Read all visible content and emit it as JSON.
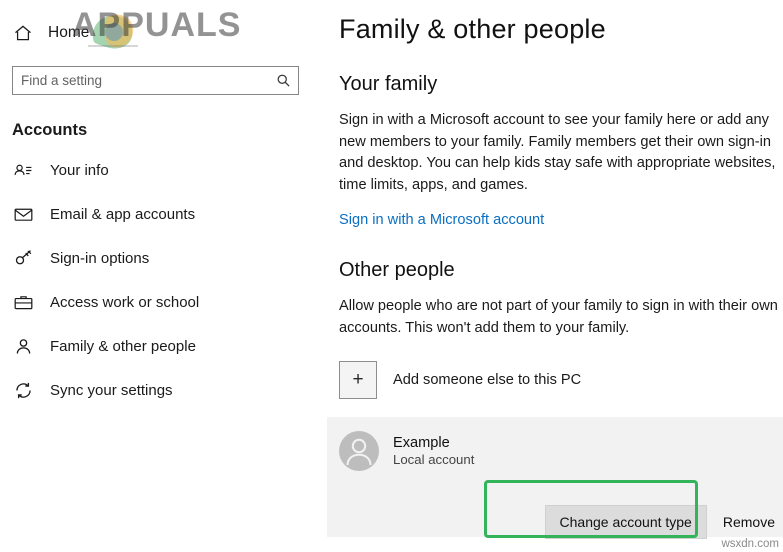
{
  "sidebar": {
    "home": {
      "label": "Home",
      "icon": "home-icon"
    },
    "search": {
      "placeholder": "Find a setting",
      "value": "",
      "icon": "search-icon"
    },
    "section_title": "Accounts",
    "items": [
      {
        "label": "Your info",
        "icon": "id-card-icon"
      },
      {
        "label": "Email & app accounts",
        "icon": "envelope-icon"
      },
      {
        "label": "Sign-in options",
        "icon": "key-icon"
      },
      {
        "label": "Access work or school",
        "icon": "briefcase-icon"
      },
      {
        "label": "Family & other people",
        "icon": "person-icon",
        "selected": true
      },
      {
        "label": "Sync your settings",
        "icon": "sync-icon"
      }
    ]
  },
  "main": {
    "page_title": "Family & other people",
    "family": {
      "heading": "Your family",
      "body": "Sign in with a Microsoft account to see your family here or add any new members to your family. Family members get their own sign-in and desktop. You can help kids stay safe with appropriate websites, time limits, apps, and games.",
      "link": "Sign in with a Microsoft account"
    },
    "other_people": {
      "heading": "Other people",
      "body": "Allow people who are not part of your family to sign in with their own accounts. This won't add them to your family.",
      "add_label": "Add someone else to this PC",
      "add_icon": "plus-icon",
      "account": {
        "avatar_icon": "user-avatar-icon",
        "name": "Example",
        "type": "Local account"
      },
      "change_button": "Change account type",
      "remove_button": "Remove"
    }
  },
  "overlay": {
    "watermark_text": "APPUALS",
    "corner_tag": "wsxdn.com",
    "highlight_color": "#34b45a"
  }
}
